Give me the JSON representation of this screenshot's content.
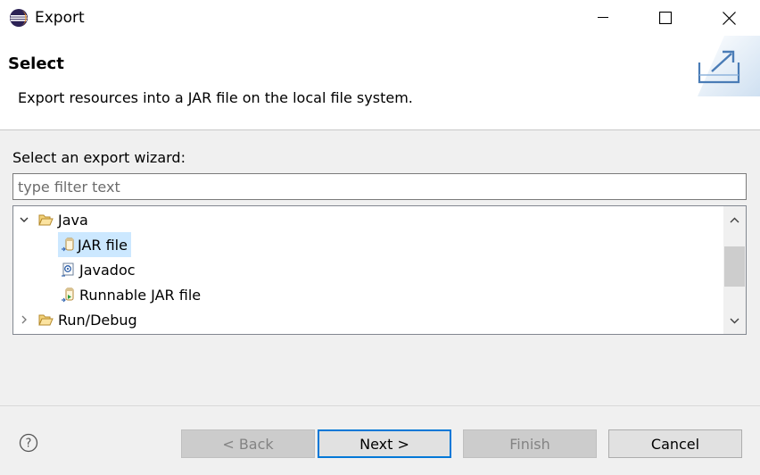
{
  "window": {
    "title": "Export"
  },
  "header": {
    "title": "Select",
    "description": "Export resources into a JAR file on the local file system."
  },
  "wizard": {
    "label": "Select an export wizard:",
    "filter_placeholder": "type filter text",
    "filter_value": ""
  },
  "tree": {
    "items": [
      {
        "label": "Java",
        "expanded": true,
        "icon": "folder-open-icon"
      },
      {
        "label": "JAR file",
        "selected": true,
        "icon": "jar-export-icon"
      },
      {
        "label": "Javadoc",
        "icon": "javadoc-icon"
      },
      {
        "label": "Runnable JAR file",
        "icon": "runnable-jar-icon"
      },
      {
        "label": "Run/Debug",
        "expanded": false,
        "icon": "folder-open-icon"
      }
    ]
  },
  "buttons": {
    "back": "< Back",
    "next": "Next >",
    "finish": "Finish",
    "cancel": "Cancel"
  },
  "colors": {
    "selection": "#cce8ff",
    "default_button_border": "#0078d7",
    "folder": "#e8b84a"
  }
}
